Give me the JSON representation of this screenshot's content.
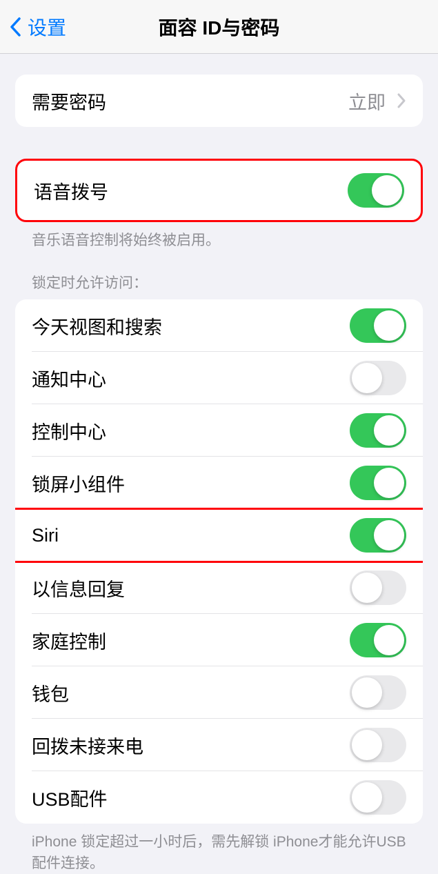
{
  "nav": {
    "back_label": "设置",
    "title": "面容 ID与密码"
  },
  "passcode_group": {
    "require_passcode_label": "需要密码",
    "require_passcode_value": "立即"
  },
  "voice_dial": {
    "label": "语音拨号",
    "footer": "音乐语音控制将始终被启用。"
  },
  "lock_access": {
    "header": "锁定时允许访问：",
    "items": [
      {
        "label": "今天视图和搜索",
        "on": true
      },
      {
        "label": "通知中心",
        "on": false
      },
      {
        "label": "控制中心",
        "on": true
      },
      {
        "label": "锁屏小组件",
        "on": true
      },
      {
        "label": "Siri",
        "on": true
      },
      {
        "label": "以信息回复",
        "on": false
      },
      {
        "label": "家庭控制",
        "on": true
      },
      {
        "label": "钱包",
        "on": false
      },
      {
        "label": "回拨未接来电",
        "on": false
      },
      {
        "label": "USB配件",
        "on": false
      }
    ],
    "footer": "iPhone 锁定超过一小时后，需先解锁 iPhone才能允许USB 配件连接。"
  }
}
